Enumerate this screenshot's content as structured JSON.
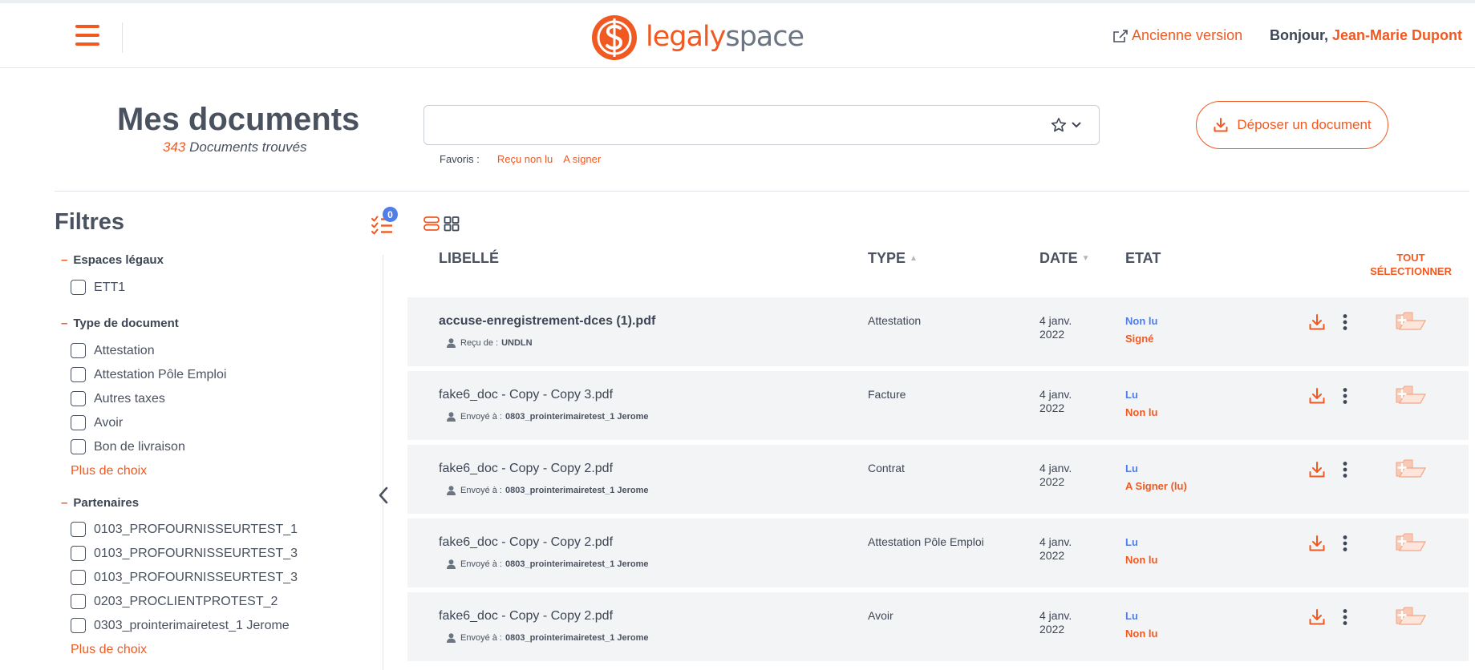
{
  "header": {
    "brand_part1": "legaly",
    "brand_part2": "space",
    "old_version_label": "Ancienne version",
    "greeting": "Bonjour,",
    "user_name": "Jean-Marie Dupont"
  },
  "page": {
    "title": "Mes documents",
    "count": "343",
    "count_label": "Documents trouvés"
  },
  "search": {
    "value": "",
    "placeholder": ""
  },
  "favorites": {
    "label": "Favoris :",
    "links": [
      "Reçu non lu",
      "A signer"
    ]
  },
  "upload_button": "Déposer un document",
  "filters": {
    "title": "Filtres",
    "active_count": "0",
    "groups": [
      {
        "title": "Espaces légaux",
        "options": [
          "ETT1"
        ]
      },
      {
        "title": "Type de document",
        "options": [
          "Attestation",
          "Attestation Pôle Emploi",
          "Autres taxes",
          "Avoir",
          "Bon de livraison"
        ],
        "more": "Plus de choix"
      },
      {
        "title": "Partenaires",
        "options": [
          "0103_PROFOURNISSEURTEST_1",
          "0103_PROFOURNISSEURTEST_3",
          "0103_PROFOURNISSEURTEST_3",
          "0203_PROCLIENTPROTEST_2",
          "0303_prointerimairetest_1 Jerome"
        ],
        "more": "Plus de choix"
      }
    ]
  },
  "table": {
    "columns": {
      "label": "LIBELLÉ",
      "type": "TYPE",
      "date": "DATE",
      "state": "ETAT"
    },
    "sort_type": "▲",
    "sort_date": "▼",
    "select_all_line1": "TOUT",
    "select_all_line2": "SÉLECTIONNER",
    "rows": [
      {
        "name": "accuse-enregistrement-dces (1).pdf",
        "unread": true,
        "party_label": "Reçu de :",
        "party": "UNDLN",
        "type": "Attestation",
        "date_l1": "4 janv.",
        "date_l2": "2022",
        "state1": "Non lu",
        "state2": "Signé"
      },
      {
        "name": "fake6_doc - Copy - Copy 3.pdf",
        "unread": false,
        "party_label": "Envoyé à :",
        "party": "0803_prointerimairetest_1 Jerome",
        "type": "Facture",
        "date_l1": "4 janv.",
        "date_l2": "2022",
        "state1": "Lu",
        "state2": "Non lu"
      },
      {
        "name": "fake6_doc - Copy - Copy 2.pdf",
        "unread": false,
        "party_label": "Envoyé à :",
        "party": "0803_prointerimairetest_1 Jerome",
        "type": "Contrat",
        "date_l1": "4 janv.",
        "date_l2": "2022",
        "state1": "Lu",
        "state2": "A Signer (lu)"
      },
      {
        "name": "fake6_doc - Copy - Copy 2.pdf",
        "unread": false,
        "party_label": "Envoyé à :",
        "party": "0803_prointerimairetest_1 Jerome",
        "type": "Attestation Pôle Emploi",
        "date_l1": "4 janv.",
        "date_l2": "2022",
        "state1": "Lu",
        "state2": "Non lu"
      },
      {
        "name": "fake6_doc - Copy - Copy 2.pdf",
        "unread": false,
        "party_label": "Envoyé à :",
        "party": "0803_prointerimairetest_1 Jerome",
        "type": "Avoir",
        "date_l1": "4 janv.",
        "date_l2": "2022",
        "state1": "Lu",
        "state2": "Non lu"
      }
    ]
  },
  "colors": {
    "accent": "#f05a22",
    "read_state": "#4f7ee8",
    "text": "#3d4654",
    "row_shade": "#f3f4f6"
  },
  "icons": [
    "menu-icon",
    "external-link-icon",
    "star-icon",
    "chevron-down-icon",
    "download-icon",
    "filter-list-icon",
    "list-view-icon",
    "grid-view-icon",
    "user-icon",
    "kebab-icon",
    "folder-select-icon",
    "chevron-left-icon"
  ]
}
